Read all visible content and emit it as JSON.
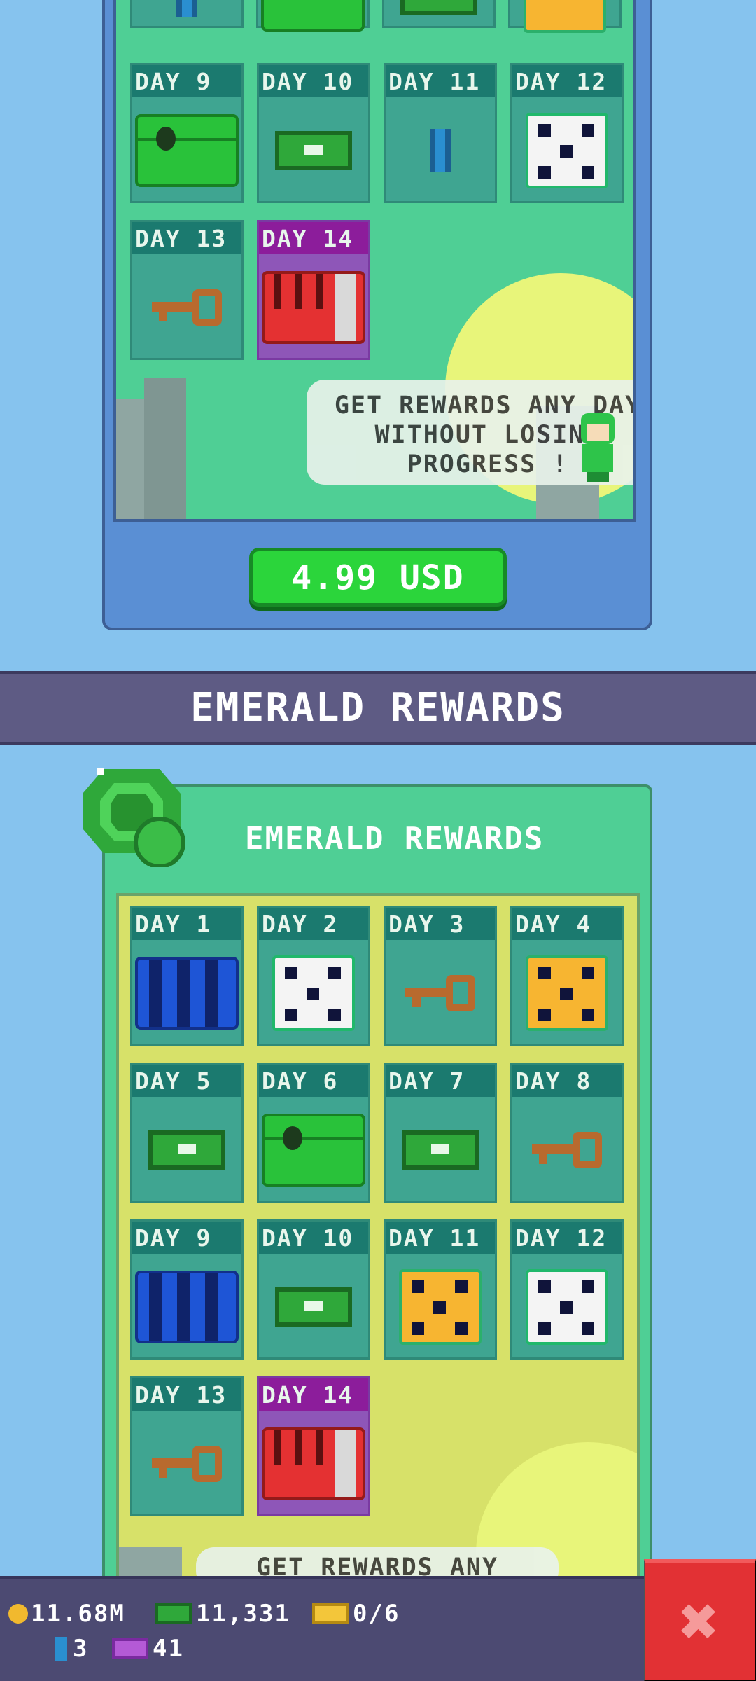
{
  "weekly_offer": {
    "days": [
      {
        "label": "DAY 9",
        "item": "green-chest"
      },
      {
        "label": "DAY 10",
        "item": "cash"
      },
      {
        "label": "DAY 11",
        "item": "gem"
      },
      {
        "label": "DAY 12",
        "item": "white-dice"
      },
      {
        "label": "DAY 13",
        "item": "key"
      },
      {
        "label": "DAY 14",
        "item": "red-chest"
      }
    ],
    "speech": "GET REWARDS ANY DAY WITHOUT LOSING PROGRESS !",
    "price": "4.99 USD"
  },
  "section_header": "EMERALD REWARDS",
  "emerald": {
    "title": "EMERALD REWARDS",
    "days": [
      {
        "label": "DAY 1",
        "item": "blue-chest"
      },
      {
        "label": "DAY 2",
        "item": "white-dice"
      },
      {
        "label": "DAY 3",
        "item": "key"
      },
      {
        "label": "DAY 4",
        "item": "gold-dice"
      },
      {
        "label": "DAY 5",
        "item": "cash"
      },
      {
        "label": "DAY 6",
        "item": "green-chest"
      },
      {
        "label": "DAY 7",
        "item": "cash"
      },
      {
        "label": "DAY 8",
        "item": "key"
      },
      {
        "label": "DAY 9",
        "item": "blue-chest"
      },
      {
        "label": "DAY 10",
        "item": "cash"
      },
      {
        "label": "DAY 11",
        "item": "gold-dice"
      },
      {
        "label": "DAY 12",
        "item": "white-dice"
      },
      {
        "label": "DAY 13",
        "item": "key"
      },
      {
        "label": "DAY 14",
        "item": "red-chest"
      }
    ],
    "speech_partial": "GET REWARDS ANY"
  },
  "hud": {
    "coins": "11.68M",
    "cash": "11,331",
    "tickets": "0/6",
    "gems": "3",
    "passes": "41",
    "close_icon": "close-x-icon"
  },
  "colors": {
    "accent_green": "#2bd53b",
    "panel_green": "#4fcf95",
    "header_purple": "#5e5b84",
    "close_red": "#e23134"
  }
}
